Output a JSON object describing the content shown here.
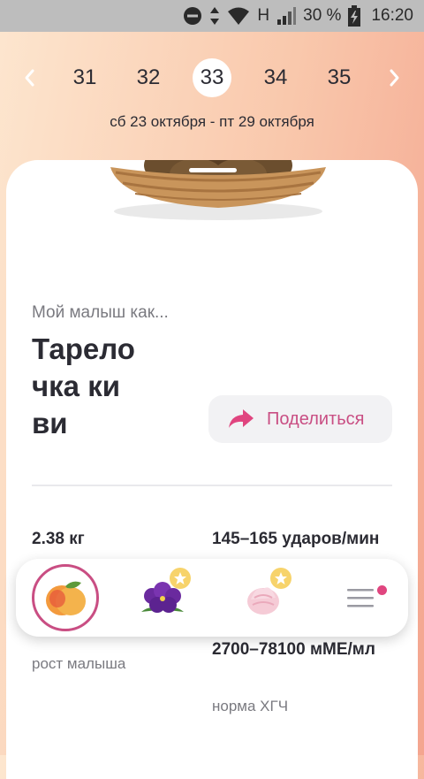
{
  "status_bar": {
    "time": "16:20",
    "battery": "30 %",
    "network": "H"
  },
  "weeks": {
    "items": [
      "31",
      "32",
      "33",
      "34",
      "35"
    ],
    "selected": "33"
  },
  "date_range": "сб 23 октября - пт 29 октября",
  "card": {
    "subtitle": "Мой малыш как...",
    "title": "Тарелочка киви",
    "share_label": "Поделиться"
  },
  "stats": {
    "weight_value": "2.38 кг",
    "heart_value": "145–165 ударов/мин",
    "height_label": "рост малыша",
    "hcg_value": "2700–78100 мМЕ/мл",
    "hcg_label": "норма ХГЧ"
  },
  "colors": {
    "accent": "#c94e83",
    "star": "#f7d36b",
    "notification": "#e0457f"
  },
  "bottom_nav": [
    {
      "icon": "peach-icon",
      "active": true
    },
    {
      "icon": "violet-flower-icon",
      "badge": "star"
    },
    {
      "icon": "marshmallow-icon",
      "badge": "star"
    },
    {
      "icon": "menu-icon",
      "notification": true
    }
  ]
}
